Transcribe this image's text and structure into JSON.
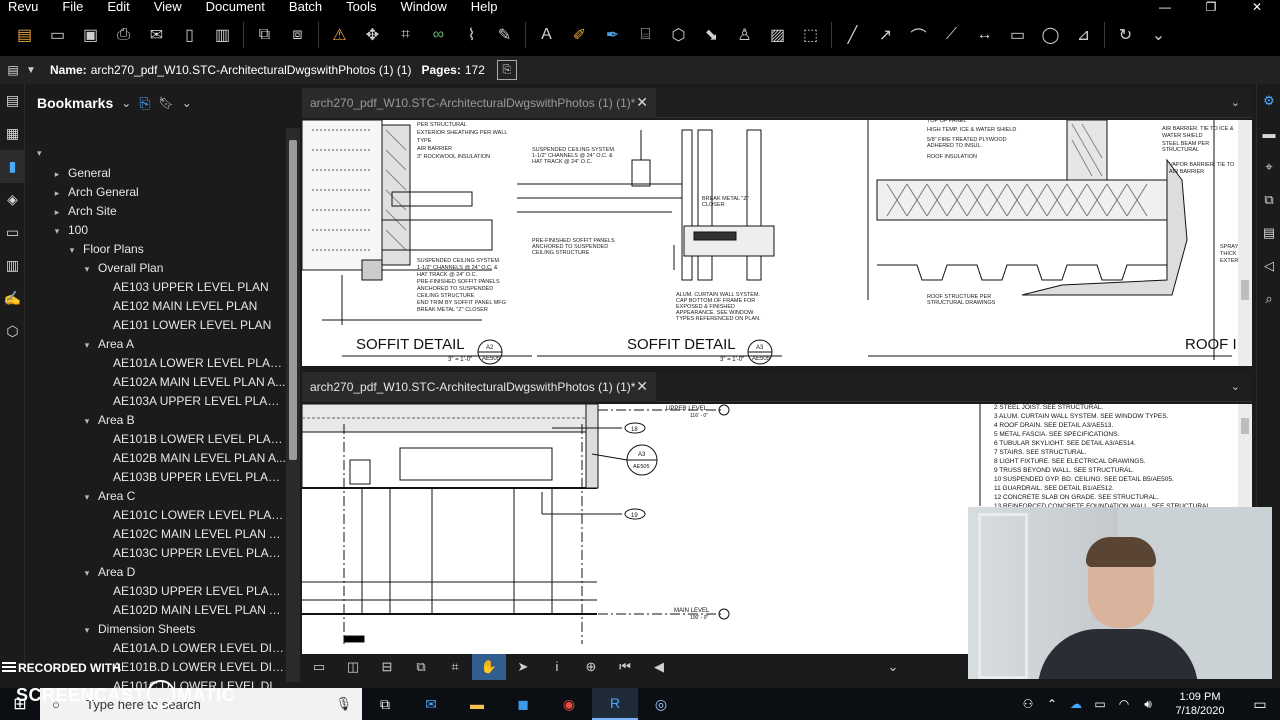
{
  "app": {
    "menu": [
      "Revu",
      "File",
      "Edit",
      "View",
      "Document",
      "Batch",
      "Tools",
      "Window",
      "Help"
    ],
    "window_controls": [
      "—",
      "❐",
      "✕"
    ]
  },
  "toolbar": {
    "icons": [
      "new-icon",
      "open-icon",
      "save-icon",
      "print-icon",
      "email-icon",
      "page-icon",
      "save-as-icon",
      "pages-icon",
      "compare-icon",
      "bell-icon",
      "cursor-icon",
      "crop-icon",
      "link-icon",
      "attach-icon",
      "eraser-icon",
      "text-icon",
      "highlight-icon",
      "pen-icon",
      "stamp-icon",
      "shape-icon",
      "callout-icon",
      "markup-icon",
      "image-icon",
      "select-icon",
      "line-icon",
      "arrow-icon",
      "arc-icon",
      "polyline-icon",
      "dimension-icon",
      "rectangle-icon",
      "ellipse-icon",
      "measure-icon",
      "rotate-icon"
    ]
  },
  "namebar": {
    "name_label": "Name:",
    "name_value": "arch270_pdf_W10.STC-ArchitecturalDwgswithPhotos (1) (1)",
    "pages_label": "Pages:",
    "pages_value": "172"
  },
  "bookmarks": {
    "title": "Bookmarks",
    "tree": [
      {
        "label": "General",
        "depth": 1,
        "toggle": "▸"
      },
      {
        "label": "Arch General",
        "depth": 1,
        "toggle": "▸"
      },
      {
        "label": "Arch Site",
        "depth": 1,
        "toggle": "▸"
      },
      {
        "label": "100",
        "depth": 1,
        "toggle": "▾"
      },
      {
        "label": "Floor Plans",
        "depth": 2,
        "toggle": "▾"
      },
      {
        "label": "Overall Plan",
        "depth": 3,
        "toggle": "▾"
      },
      {
        "label": "AE103 UPPER LEVEL PLAN",
        "depth": 4,
        "toggle": ""
      },
      {
        "label": "AE102  MAIN LEVEL PLAN",
        "depth": 4,
        "toggle": ""
      },
      {
        "label": "AE101  LOWER LEVEL PLAN",
        "depth": 4,
        "toggle": ""
      },
      {
        "label": "Area A",
        "depth": 3,
        "toggle": "▾"
      },
      {
        "label": "AE101A  LOWER LEVEL PLAN ...",
        "depth": 4,
        "toggle": ""
      },
      {
        "label": "AE102A  MAIN LEVEL PLAN A...",
        "depth": 4,
        "toggle": ""
      },
      {
        "label": "AE103A UPPER LEVEL PLAN ...",
        "depth": 4,
        "toggle": ""
      },
      {
        "label": "Area B",
        "depth": 3,
        "toggle": "▾"
      },
      {
        "label": "AE101B  LOWER LEVEL PLAN ...",
        "depth": 4,
        "toggle": ""
      },
      {
        "label": "AE102B MAIN LEVEL PLAN A...",
        "depth": 4,
        "toggle": ""
      },
      {
        "label": "AE103B UPPER LEVEL PLAN ...",
        "depth": 4,
        "toggle": ""
      },
      {
        "label": "Area C",
        "depth": 3,
        "toggle": "▾"
      },
      {
        "label": "AE101C  LOWER LEVEL PLAN ...",
        "depth": 4,
        "toggle": ""
      },
      {
        "label": "AE102C MAIN LEVEL PLAN A...",
        "depth": 4,
        "toggle": ""
      },
      {
        "label": "AE103C UPPER LEVEL PLAN ...",
        "depth": 4,
        "toggle": ""
      },
      {
        "label": "Area D",
        "depth": 3,
        "toggle": "▾"
      },
      {
        "label": "AE103D UPPER LEVEL PLAN ...",
        "depth": 4,
        "toggle": ""
      },
      {
        "label": "AE102D MAIN LEVEL PLAN A...",
        "depth": 4,
        "toggle": ""
      },
      {
        "label": "Dimension Sheets",
        "depth": 3,
        "toggle": "▾"
      },
      {
        "label": "AE101A.D  LOWER LEVEL DIM...",
        "depth": 4,
        "toggle": ""
      },
      {
        "label": "AE101B.D  LOWER LEVEL DIM...",
        "depth": 4,
        "toggle": ""
      },
      {
        "label": "AE101C.D  LOWER LEVEL DIM...",
        "depth": 4,
        "toggle": ""
      }
    ]
  },
  "tabs": {
    "top_title": "arch270_pdf_W10.STC-ArchitecturalDwgswithPhotos (1) (1)*",
    "bottom_title": "arch270_pdf_W10.STC-ArchitecturalDwgswithPhotos (1) (1)*"
  },
  "drawing_top": {
    "detail1_title": "SOFFIT DETAIL",
    "detail1_scale": "3\" = 1'-0\"",
    "detail1_tag": "A2",
    "detail1_sheet": "AE505",
    "detail2_title": "SOFFIT DETAIL",
    "detail2_scale": "3\" = 1'-0\"",
    "detail2_tag": "A3",
    "detail2_sheet": "AE505",
    "detail3_title": "ROOF I",
    "notes_left": [
      "PER STRUCTURAL",
      "EXTERIOR SHEATHING PER WALL",
      "TYPE",
      "AIR BARRIER",
      "3\" ROCKWOOL INSULATION"
    ],
    "notes_left_low": [
      "SUSPENDED CEILING SYSTEM.",
      "1-1/2\" CHANNELS @ 24\" O.C. &",
      "HAT TRACK @ 24\" O.C.",
      "PRE-FINISHED SOFFIT PANELS",
      "ANCHORED TO SUSPENDED",
      "CEILING STRUCTURE",
      "END TRIM BY SOFFIT PANEL MFG",
      "BREAK METAL \"Z\" CLOSER"
    ],
    "notes_mid": [
      "SUSPENDED CEILING SYSTEM.",
      "1-1/2\" CHANNELS @ 24\" O.C. &",
      "HAT TRACK @ 24\" O.C.",
      "BREAK METAL \"Z\"",
      "CLOSER",
      "PRE-FINISHED SOFFIT PANELS",
      "ANCHORED TO SUSPENDED",
      "CEILING STRUCTURE",
      "ALUM. CURTAIN WALL SYSTEM.",
      "CAP BOTTOM OF FRAME FOR",
      "EXPOSED & FINISHED",
      "APPEARANCE. SEE WINDOW",
      "TYPES REFERENCED ON PLAN."
    ],
    "notes_right": [
      "TOP OF PANEL",
      "HIGH TEMP. ICE & WATER SHIELD",
      "5/8\" FIRE TREATED PLYWOOD",
      "ADHERED TO INSUL.",
      "ROOF INSULATION",
      "ROOF STRUCTURE PER",
      "STRUCTURAL DRAWINGS"
    ],
    "notes_far_right": [
      "AIR BARRIER. TIE TO ICE &",
      "WATER SHIELD",
      "STEEL BEAM PER",
      "STRUCTURAL",
      "VAPOR BARRIER. TIE TO",
      "AIR BARRIER",
      "SPRAY",
      "THICK",
      "EXTER"
    ]
  },
  "drawing_bottom": {
    "upper_level": "UPPER LEVEL",
    "upper_level_elev": "116' - 0\"",
    "main_level": "MAIN LEVEL",
    "main_level_elev": "100' - 0\"",
    "tag_18": "18",
    "tag_19": "19",
    "detail_tag": "A3",
    "detail_sheet": "AE505",
    "legend": [
      "2   STEEL JOIST. SEE STRUCTURAL.",
      "3   ALUM. CURTAIN WALL SYSTEM. SEE WINDOW TYPES.",
      "4   ROOF DRAIN. SEE DETAIL A3/AE513.",
      "5   METAL FASCIA. SEE SPECIFICATIONS.",
      "6   TUBULAR SKYLIGHT. SEE DETAIL A3/AE514.",
      "7   STAIRS. SEE STRUCTURAL.",
      "8   LIGHT FIXTURE. SEE ELECTRICAL DRAWINGS.",
      "9   TRUSS BEYOND WALL. SEE STRUCTURAL.",
      "10  SUSPENDED GYP. BD. CEILING. SEE DETAIL B5/AE505.",
      "11  GUARDRAIL. SEE DETAIL B1/AE512.",
      "12  CONCRETE SLAB ON GRADE. SEE STRUCTURAL.",
      "13  REINFORCED CONCRETE FOUNDATION WALL. SEE STRUCTURAL."
    ]
  },
  "overlay": {
    "recorded_with": "RECORDED WITH",
    "brand_left": "SCREENCAST",
    "brand_right": "MATIC"
  },
  "taskbar": {
    "search_placeholder": "Type here to search",
    "time": "1:09 PM",
    "date": "7/18/2020"
  },
  "colors": {
    "accent": "#4aa8ff",
    "orange_icon": "#e7a23a",
    "background": "#1b1b1b"
  }
}
